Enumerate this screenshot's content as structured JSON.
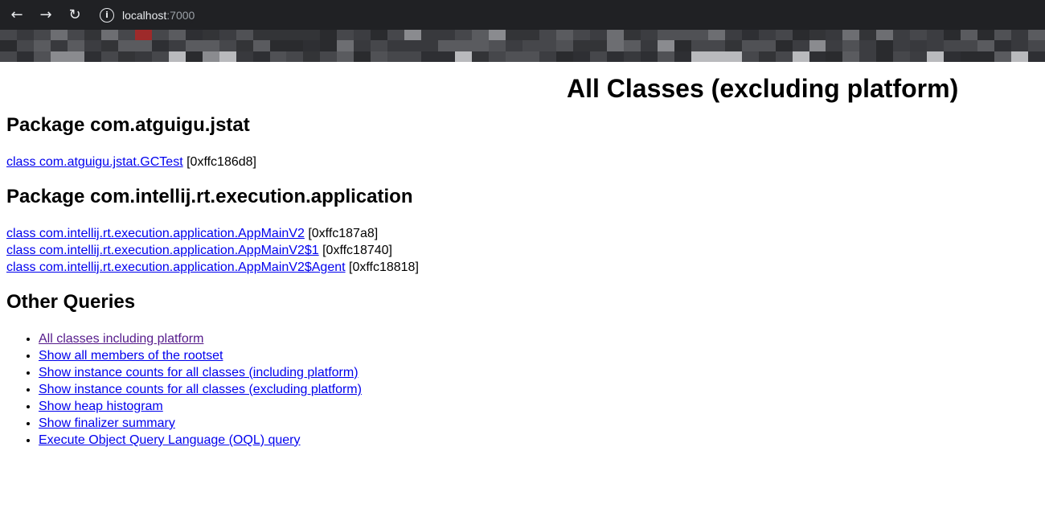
{
  "browser": {
    "back_icon": "arrow-left-icon",
    "forward_icon": "arrow-right-icon",
    "reload_icon": "reload-icon",
    "info_icon": "info-icon",
    "url_host": "localhost",
    "url_port": ":7000"
  },
  "page": {
    "title": "All Classes (excluding platform)",
    "packages": [
      {
        "heading": "Package com.atguigu.jstat",
        "classes": [
          {
            "name": "class com.atguigu.jstat.GCTest",
            "addr": "[0xffc186d8]"
          }
        ]
      },
      {
        "heading": "Package com.intellij.rt.execution.application",
        "classes": [
          {
            "name": "class com.intellij.rt.execution.application.AppMainV2",
            "addr": "[0xffc187a8]"
          },
          {
            "name": "class com.intellij.rt.execution.application.AppMainV2$1",
            "addr": "[0xffc18740]"
          },
          {
            "name": "class com.intellij.rt.execution.application.AppMainV2$Agent",
            "addr": "[0xffc18818]"
          }
        ]
      }
    ],
    "other_heading": "Other Queries",
    "queries": [
      "All classes including platform",
      "Show all members of the rootset",
      "Show instance counts for all classes (including platform)",
      "Show instance counts for all classes (excluding platform)",
      "Show heap histogram",
      "Show finalizer summary",
      "Execute Object Query Language (OQL) query"
    ]
  },
  "colors": {
    "chrome_bg": "#202124",
    "link": "#0000ee",
    "visited_link": "#551a8b"
  }
}
